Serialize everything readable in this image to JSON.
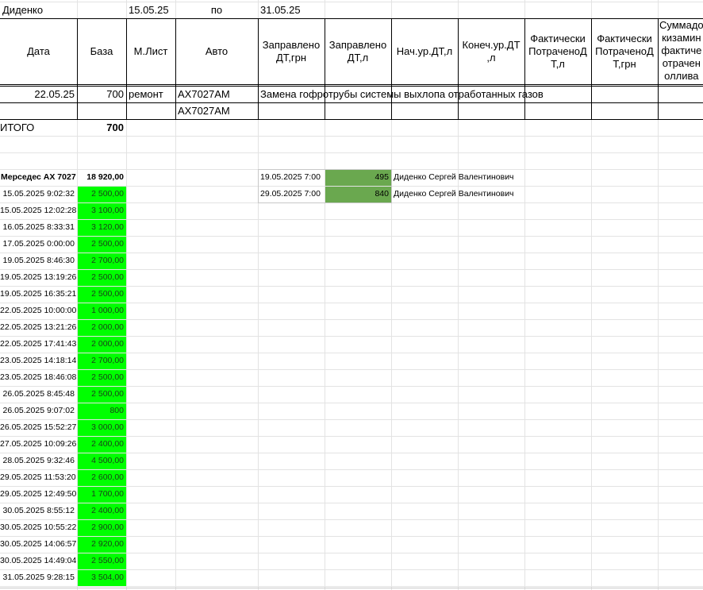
{
  "header_row": {
    "name": "Диденко",
    "date_from": "15.05.25",
    "date_sep": "по",
    "date_to": "31.05.25"
  },
  "columns": [
    "Дата",
    "База",
    "М.Лист",
    "Авто",
    "Заправлено ДТ,грн",
    "Заправлено ДТ,л",
    "Нач.ур.ДТ,л",
    "Конеч.ур.ДТ ,л",
    "Фактически ПотраченоД Т,л",
    "Фактически ПотраченоД Т,грн",
    "Суммадо кизамин фактиче отрачен оллива"
  ],
  "entries": [
    {
      "date": "22.05.25",
      "base": "700",
      "sheet": "ремонт",
      "auto": "АХ7027АМ",
      "note": "Замена гофротрубы системы выхлопа отработанных газов"
    },
    {
      "date": "",
      "base": "",
      "sheet": "",
      "auto": "АХ7027АМ",
      "note": ""
    }
  ],
  "total": {
    "label": "ИТОГО",
    "value": "700"
  },
  "fuel_block": {
    "vehicle": "Мерседес АХ 7027",
    "sum": "18 920,00",
    "rows": [
      {
        "ts": "15.05.2025 9:02:32",
        "amt": "2 500,00"
      },
      {
        "ts": "15.05.2025 12:02:28",
        "amt": "3 100,00"
      },
      {
        "ts": "16.05.2025 8:33:31",
        "amt": "3 120,00"
      },
      {
        "ts": "17.05.2025 0:00:00",
        "amt": "2 500,00"
      },
      {
        "ts": "19.05.2025 8:46:30",
        "amt": "2 700,00"
      },
      {
        "ts": "19.05.2025 13:19:26",
        "amt": "2 500,00"
      },
      {
        "ts": "19.05.2025 16:35:21",
        "amt": "2 500,00"
      },
      {
        "ts": "22.05.2025 10:00:00",
        "amt": "1 000,00"
      },
      {
        "ts": "22.05.2025 13:21:26",
        "amt": "2 000,00"
      },
      {
        "ts": "22.05.2025 17:41:43",
        "amt": "2 000,00"
      },
      {
        "ts": "23.05.2025 14:18:14",
        "amt": "2 700,00"
      },
      {
        "ts": "23.05.2025 18:46:08",
        "amt": "2 500,00"
      },
      {
        "ts": "26.05.2025 8:45:48",
        "amt": "2 500,00"
      },
      {
        "ts": "26.05.2025 9:07:02",
        "amt": "800"
      },
      {
        "ts": "26.05.2025 15:52:27",
        "amt": "3 000,00"
      },
      {
        "ts": "27.05.2025 10:09:26",
        "amt": "2 400,00"
      },
      {
        "ts": "28.05.2025 9:32:46",
        "amt": "4 500,00"
      },
      {
        "ts": "29.05.2025 11:53:20",
        "amt": "2 600,00"
      },
      {
        "ts": "29.05.2025 12:49:50",
        "amt": "1 700,00"
      },
      {
        "ts": "30.05.2025 8:55:12",
        "amt": "2 400,00"
      },
      {
        "ts": "30.05.2025 10:55:22",
        "amt": "2 900,00"
      },
      {
        "ts": "30.05.2025 14:06:57",
        "amt": "2 920,00"
      },
      {
        "ts": "30.05.2025 14:49:04",
        "amt": "2 550,00"
      },
      {
        "ts": "31.05.2025 9:28:15",
        "amt": "3 504,00"
      }
    ]
  },
  "side_records": [
    {
      "ts": "19.05.2025 7:00",
      "value": "495",
      "driver": "Диденко Сергей Валентинович"
    },
    {
      "ts": "29.05.2025 7:00",
      "value": "840",
      "driver": "Диденко Сергей Валентинович"
    }
  ],
  "colors": {
    "fill_green": "#00ff00",
    "fill_dark_green": "#6aa84f",
    "grid": "#e3e3e3"
  }
}
